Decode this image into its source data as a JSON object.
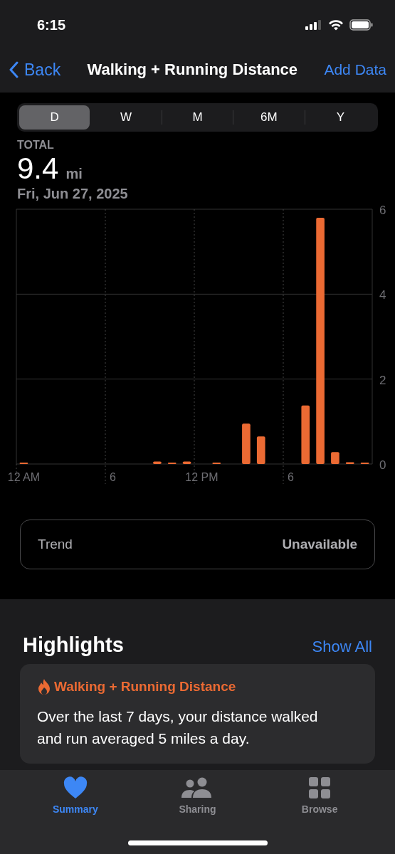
{
  "status_bar": {
    "time": "6:15"
  },
  "nav": {
    "back": "Back",
    "title": "Walking + Running Distance",
    "action": "Add Data"
  },
  "segments": [
    {
      "label": "D",
      "selected": true
    },
    {
      "label": "W",
      "selected": false
    },
    {
      "label": "M",
      "selected": false
    },
    {
      "label": "6M",
      "selected": false
    },
    {
      "label": "Y",
      "selected": false
    }
  ],
  "summary": {
    "label": "TOTAL",
    "value": "9.4",
    "unit": "mi",
    "date": "Fri, Jun 27, 2025"
  },
  "chart": {
    "chart_data": {
      "type": "bar",
      "categories": [
        "12 AM",
        null,
        null,
        null,
        null,
        null,
        "6",
        null,
        null,
        null,
        null,
        null,
        "12 PM",
        null,
        null,
        null,
        null,
        null,
        "6",
        null,
        null,
        null,
        null,
        null
      ],
      "series": [
        {
          "color": "#eb6a33",
          "values": [
            0.01,
            0,
            0,
            0,
            0,
            0,
            0,
            0,
            0,
            0.06,
            0.03,
            0.06,
            0,
            0.02,
            0,
            0.95,
            0.65,
            0,
            0,
            1.38,
            5.8,
            0.28,
            0.04,
            0.01
          ]
        }
      ],
      "ylim": [
        0,
        6
      ],
      "yticks": [
        0,
        2,
        4,
        6
      ]
    }
  },
  "trend": {
    "label": "Trend",
    "value": "Unavailable"
  },
  "highlights": {
    "title": "Highlights",
    "action": "Show All",
    "card": {
      "title": "Walking + Running Distance",
      "text": "Over the last 7 days, your distance walked and run averaged 5 miles a day."
    }
  },
  "tab_bar": [
    {
      "label": "Summary",
      "selected": true
    },
    {
      "label": "Sharing",
      "selected": false
    },
    {
      "label": "Browse",
      "selected": false
    }
  ]
}
